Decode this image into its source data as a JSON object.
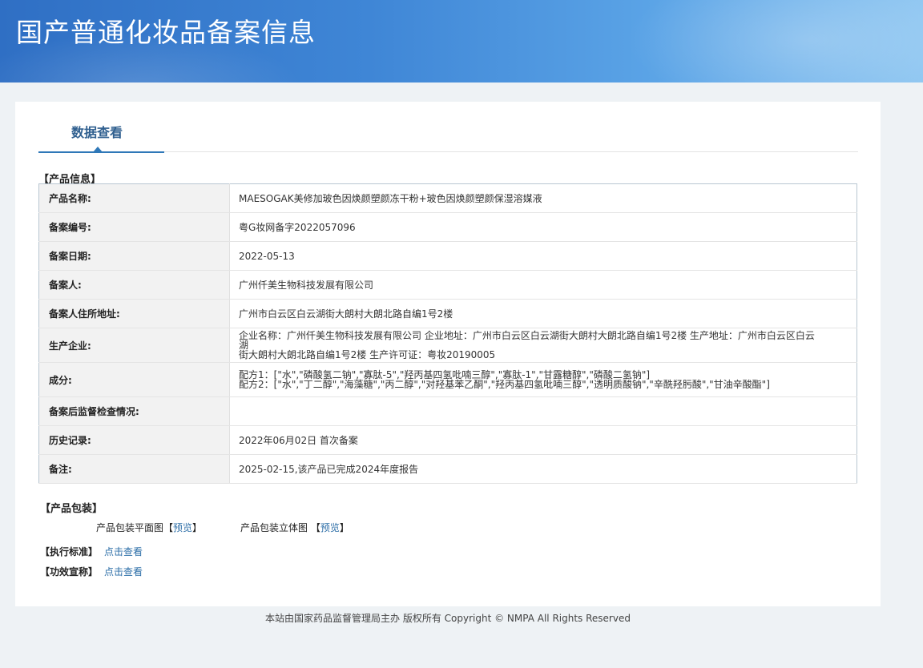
{
  "header": {
    "title": "国产普通化妆品备案信息"
  },
  "tabs": [
    {
      "label": "数据查看"
    }
  ],
  "product_info": {
    "section_title": "【产品信息】",
    "rows": [
      {
        "key": "产品名称:",
        "value": "MAESOGAK美修加玻色因焕颜塑颜冻干粉+玻色因焕颜塑颜保湿溶媒液"
      },
      {
        "key": "备案编号:",
        "value": "粤G妆网备字2022057096"
      },
      {
        "key": "备案日期:",
        "value": "2022-05-13"
      },
      {
        "key": "备案人:",
        "value": "广州仟美生物科技发展有限公司"
      },
      {
        "key": "备案人住所地址:",
        "value": "广州市白云区白云湖街大朗村大朗北路自编1号2楼"
      },
      {
        "key": "生产企业:",
        "value_lines": [
          "企业名称：广州仟美生物科技发展有限公司 企业地址：广州市白云区白云湖街大朗村大朗北路自编1号2楼 生产地址：广州市白云区白云湖",
          "街大朗村大朗北路自编1号2楼 生产许可证：粤妆20190005"
        ]
      },
      {
        "key": "成分:",
        "value_lines": [
          "配方1：[\"水\",\"磷酸氢二钠\",\"寡肽-5\",\"羟丙基四氢吡喃三醇\",\"寡肽-1\",\"甘露糖醇\",\"磷酸二氢钠\"]",
          "配方2：[\"水\",\"丁二醇\",\"海藻糖\",\"丙二醇\",\"对羟基苯乙酮\",\"羟丙基四氢吡喃三醇\",\"透明质酸钠\",\"辛酰羟肟酸\",\"甘油辛酸酯\"]"
        ]
      },
      {
        "key": "备案后监督检查情况:",
        "value": ""
      },
      {
        "key": "历史记录:",
        "value": "2022年06月02日 首次备案"
      },
      {
        "key": "备注:",
        "value": "2025-02-15,该产品已完成2024年度报告"
      }
    ]
  },
  "packaging": {
    "section_title": "【产品包装】",
    "flat_label": "产品包装平面图",
    "flat_link": "预览",
    "solid_label": "产品包装立体图",
    "solid_link": "预览",
    "bracket_open": "【",
    "bracket_close": "】"
  },
  "standard": {
    "label": "【执行标准】",
    "link": "点击查看"
  },
  "efficacy": {
    "label": "【功效宣称】",
    "link": "点击查看"
  },
  "footer": {
    "text": "本站由国家药品监督管理局主办 版权所有 Copyright © NMPA All Rights Reserved"
  }
}
